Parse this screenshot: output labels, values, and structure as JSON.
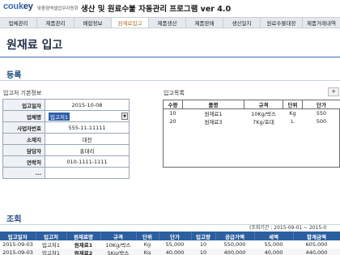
{
  "header": {
    "logo_main": "couk",
    "logo_accent": "ey",
    "tagline": "맞춤형엑셀업무자동화",
    "title": "생산 및 원료수불 자동관리 프로그램 ver 4.0"
  },
  "nav": {
    "tabs": [
      {
        "label": "업체관리",
        "active": false
      },
      {
        "label": "제품관리",
        "active": false
      },
      {
        "label": "배합정보",
        "active": false
      },
      {
        "label": "원재료입고",
        "active": true
      },
      {
        "label": "제품생산",
        "active": false
      },
      {
        "label": "제품판매",
        "active": false
      },
      {
        "label": "생산일지",
        "active": false
      },
      {
        "label": "원료수불대장",
        "active": false
      },
      {
        "label": "제품거래내역",
        "active": false
      }
    ]
  },
  "page": {
    "title": "원재료 입고",
    "register_heading": "등록",
    "search_heading": "조회"
  },
  "supplier_form": {
    "heading": "입고처 기본정보",
    "rows": [
      {
        "label": "입고일자",
        "value": "2015-10-08"
      },
      {
        "label": "업체명",
        "value": "입고처1"
      },
      {
        "label": "사업자번호",
        "value": "555-11-11111"
      },
      {
        "label": "소재지",
        "value": "대전"
      },
      {
        "label": "담당자",
        "value": "홍대리"
      },
      {
        "label": "연락처",
        "value": "010-1111-1111"
      },
      {
        "label": "...",
        "value": ""
      }
    ]
  },
  "items": {
    "heading": "입고목록",
    "add_label": "+",
    "columns": [
      "수량",
      "품명",
      "규격",
      "단위",
      "단가"
    ],
    "rows": [
      [
        "10",
        "원재료1",
        "10Kg/박스",
        "Kg",
        "550"
      ],
      [
        "20",
        "원재료3",
        "7Kg/포대",
        "L",
        "500"
      ]
    ]
  },
  "history": {
    "range_note": "(조회기간 : 2015-09-01 ~ 2015-0",
    "columns": [
      "입고일자",
      "입고처",
      "원재료명",
      "규격",
      "단위",
      "단가",
      "입고량",
      "공급가액",
      "세액",
      "합계금액"
    ],
    "rows": [
      [
        "2015-09-03",
        "입고처1",
        "원재료1",
        "10Kg/박스",
        "Kg",
        "55,000",
        "10",
        "550,000",
        "55,000",
        "605,000"
      ],
      [
        "2015-09-03",
        "입고처1",
        "원재료2",
        "5Kg/박스",
        "Kg",
        "40,000",
        "10",
        "400,000",
        "40,000",
        "440,000"
      ]
    ]
  }
}
